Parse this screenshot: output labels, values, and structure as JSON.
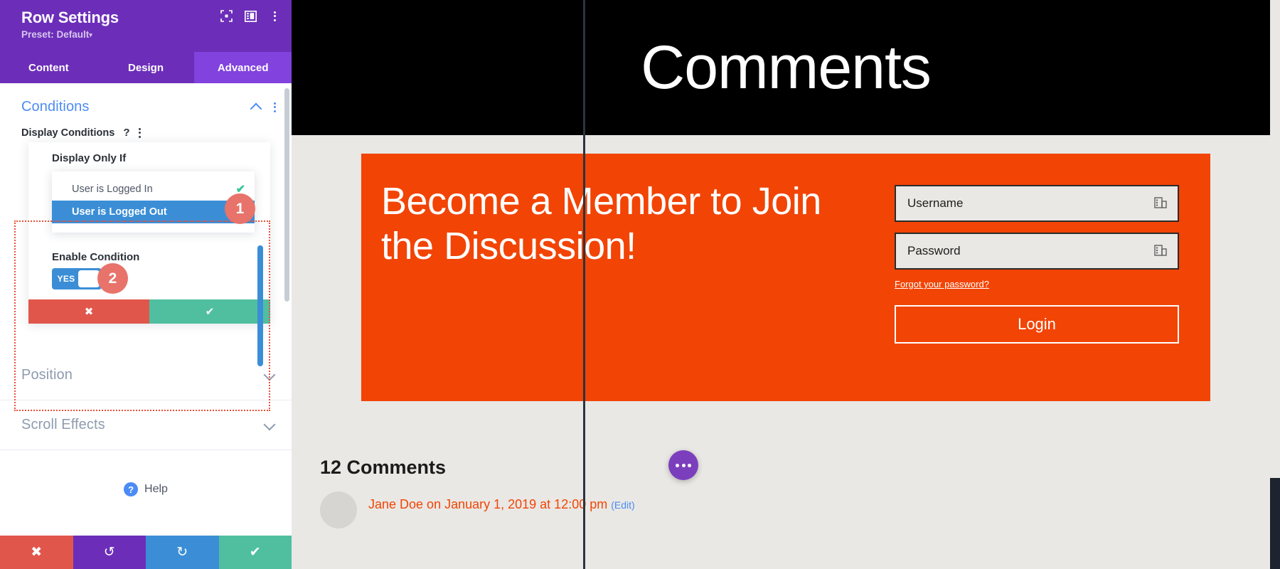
{
  "panel": {
    "title": "Row Settings",
    "preset": "Preset: Default",
    "preset_caret": "▾",
    "header_icons": [
      {
        "name": "fullscreen-icon",
        "glyph": "⬚"
      },
      {
        "name": "layout-columns-icon",
        "glyph": "▤"
      },
      {
        "name": "more-options-icon",
        "glyph": "⋮"
      }
    ],
    "tabs": [
      {
        "label": "Content",
        "active": false
      },
      {
        "label": "Design",
        "active": false
      },
      {
        "label": "Advanced",
        "active": true
      }
    ],
    "conditions": {
      "title": "Conditions",
      "display_conditions_label": "Display Conditions",
      "help_glyph": "?",
      "only_if_label": "Display Only If",
      "options": [
        {
          "label": "User is Logged In",
          "selected": false,
          "checked": true
        },
        {
          "label": "User is Logged Out",
          "selected": true,
          "checked": false
        }
      ],
      "check_glyph": "✔",
      "enable_label": "Enable Condition",
      "toggle_value": "YES",
      "cancel_glyph": "✖",
      "confirm_glyph": "✔"
    },
    "position_title": "Position",
    "scroll_effects_title": "Scroll Effects",
    "help": {
      "label": "Help",
      "glyph": "?"
    },
    "footer": [
      {
        "name": "discard-button",
        "glyph": "✖",
        "color": "#E1564B"
      },
      {
        "name": "undo-button",
        "glyph": "↺",
        "color": "#6C2EB9"
      },
      {
        "name": "redo-button",
        "glyph": "↻",
        "color": "#3B8ED6"
      },
      {
        "name": "save-button",
        "glyph": "✔",
        "color": "#4FBFA0"
      }
    ],
    "callouts": [
      {
        "number": "1"
      },
      {
        "number": "2"
      }
    ]
  },
  "preview": {
    "hero_title": "Comments",
    "member": {
      "heading": "Become a Member to Join the Discussion!",
      "username_placeholder": "Username",
      "password_placeholder": "Password",
      "forgot_link": "Forgot your password?",
      "login_label": "Login"
    },
    "comments": {
      "count_heading": "12 Comments",
      "first_comment_meta": "Jane Doe on January 1, 2019 at 12:00 pm",
      "edit_label": "(Edit)"
    }
  },
  "colors": {
    "brand_purple": "#6C2EB9",
    "tab_active": "#8142DE",
    "accent_blue": "#4C8BF5",
    "select_blue": "#3B8ED6",
    "green": "#4FBFA0",
    "red": "#E1564B",
    "badge_red": "#E8736A",
    "orange": "#F24405"
  }
}
